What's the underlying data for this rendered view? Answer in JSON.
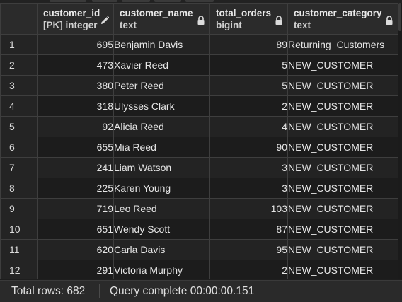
{
  "columns": [
    {
      "name": "customer_id",
      "type": "[PK] integer",
      "icon": "pencil-icon"
    },
    {
      "name": "customer_name",
      "type": "text",
      "icon": "lock-icon"
    },
    {
      "name": "total_orders",
      "type": "bigint",
      "icon": "lock-icon"
    },
    {
      "name": "customer_category",
      "type": "text",
      "icon": "lock-icon"
    }
  ],
  "rows": [
    {
      "n": "1",
      "id": "695",
      "name": "Benjamin Davis",
      "orders": "89",
      "category": "Returning_Customers"
    },
    {
      "n": "2",
      "id": "473",
      "name": "Xavier Reed",
      "orders": "5",
      "category": "NEW_CUSTOMER"
    },
    {
      "n": "3",
      "id": "380",
      "name": "Peter Reed",
      "orders": "5",
      "category": "NEW_CUSTOMER"
    },
    {
      "n": "4",
      "id": "318",
      "name": "Ulysses Clark",
      "orders": "2",
      "category": "NEW_CUSTOMER"
    },
    {
      "n": "5",
      "id": "92",
      "name": "Alicia Reed",
      "orders": "4",
      "category": "NEW_CUSTOMER"
    },
    {
      "n": "6",
      "id": "655",
      "name": "Mia Reed",
      "orders": "90",
      "category": "NEW_CUSTOMER"
    },
    {
      "n": "7",
      "id": "241",
      "name": "Liam Watson",
      "orders": "3",
      "category": "NEW_CUSTOMER"
    },
    {
      "n": "8",
      "id": "225",
      "name": "Karen Young",
      "orders": "3",
      "category": "NEW_CUSTOMER"
    },
    {
      "n": "9",
      "id": "719",
      "name": "Leo Reed",
      "orders": "103",
      "category": "NEW_CUSTOMER"
    },
    {
      "n": "10",
      "id": "651",
      "name": "Wendy Scott",
      "orders": "87",
      "category": "NEW_CUSTOMER"
    },
    {
      "n": "11",
      "id": "620",
      "name": "Carla Davis",
      "orders": "95",
      "category": "NEW_CUSTOMER"
    },
    {
      "n": "12",
      "id": "291",
      "name": "Victoria Murphy",
      "orders": "2",
      "category": "NEW_CUSTOMER"
    }
  ],
  "status": {
    "total_rows": "Total rows: 682",
    "query": "Query complete 00:00:00.151"
  },
  "colors": {
    "background": "#1e1e1e",
    "header_bg": "#2b2b2b",
    "grid_line": "#3e3e3e",
    "text": "#e6e6e6"
  }
}
